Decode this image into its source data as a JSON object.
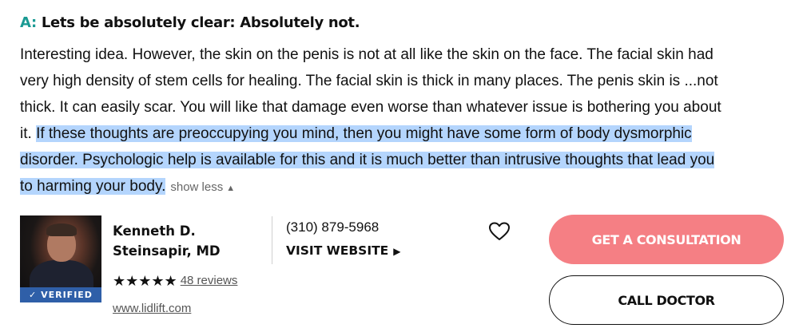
{
  "answer": {
    "prefix": "A:",
    "heading": "Lets be absolutely clear: Absolutely not.",
    "lines": [
      "Interesting idea.  However, the skin on the penis is not at all like the skin on the face.  The facial skin had",
      "very high density of stem cells for healing.  The facial skin is thick in many places.  The penis skin is ...not",
      "thick.  It can easily scar.  You will like that damage even worse than whatever issue is bothering you about"
    ],
    "line4_plain": "it. ",
    "line4_highlight": "If these thoughts are preoccupying you mind, then you might have some form of body dysmorphic",
    "line5_highlight": "disorder.  Psychologic help is available for this and it is much better than intrusive thoughts that lead you",
    "line6_highlight": "to harming your body.",
    "show_less": "show less",
    "show_less_icon": "caret-up-icon",
    "highlight_color": "#b4d5fd"
  },
  "doctor": {
    "name_line1": "Kenneth D.",
    "name_line2": "Steinsapir, MD",
    "verified_label": "✓ VERIFIED",
    "stars": "★★★★★",
    "rating": 5,
    "reviews_label": "48 reviews",
    "website": "www.lidlift.com",
    "phone": "(310) 879-5968",
    "visit_label": "VISIT WEBSITE",
    "visit_icon": "play-arrow-icon"
  },
  "actions": {
    "favorite_icon": "heart-outline-icon",
    "consult_label": "GET A CONSULTATION",
    "call_label": "CALL DOCTOR"
  },
  "colors": {
    "accent": "#1a9a93",
    "consult_button": "#f57f84",
    "verified_badge": "#2f5fa8"
  }
}
